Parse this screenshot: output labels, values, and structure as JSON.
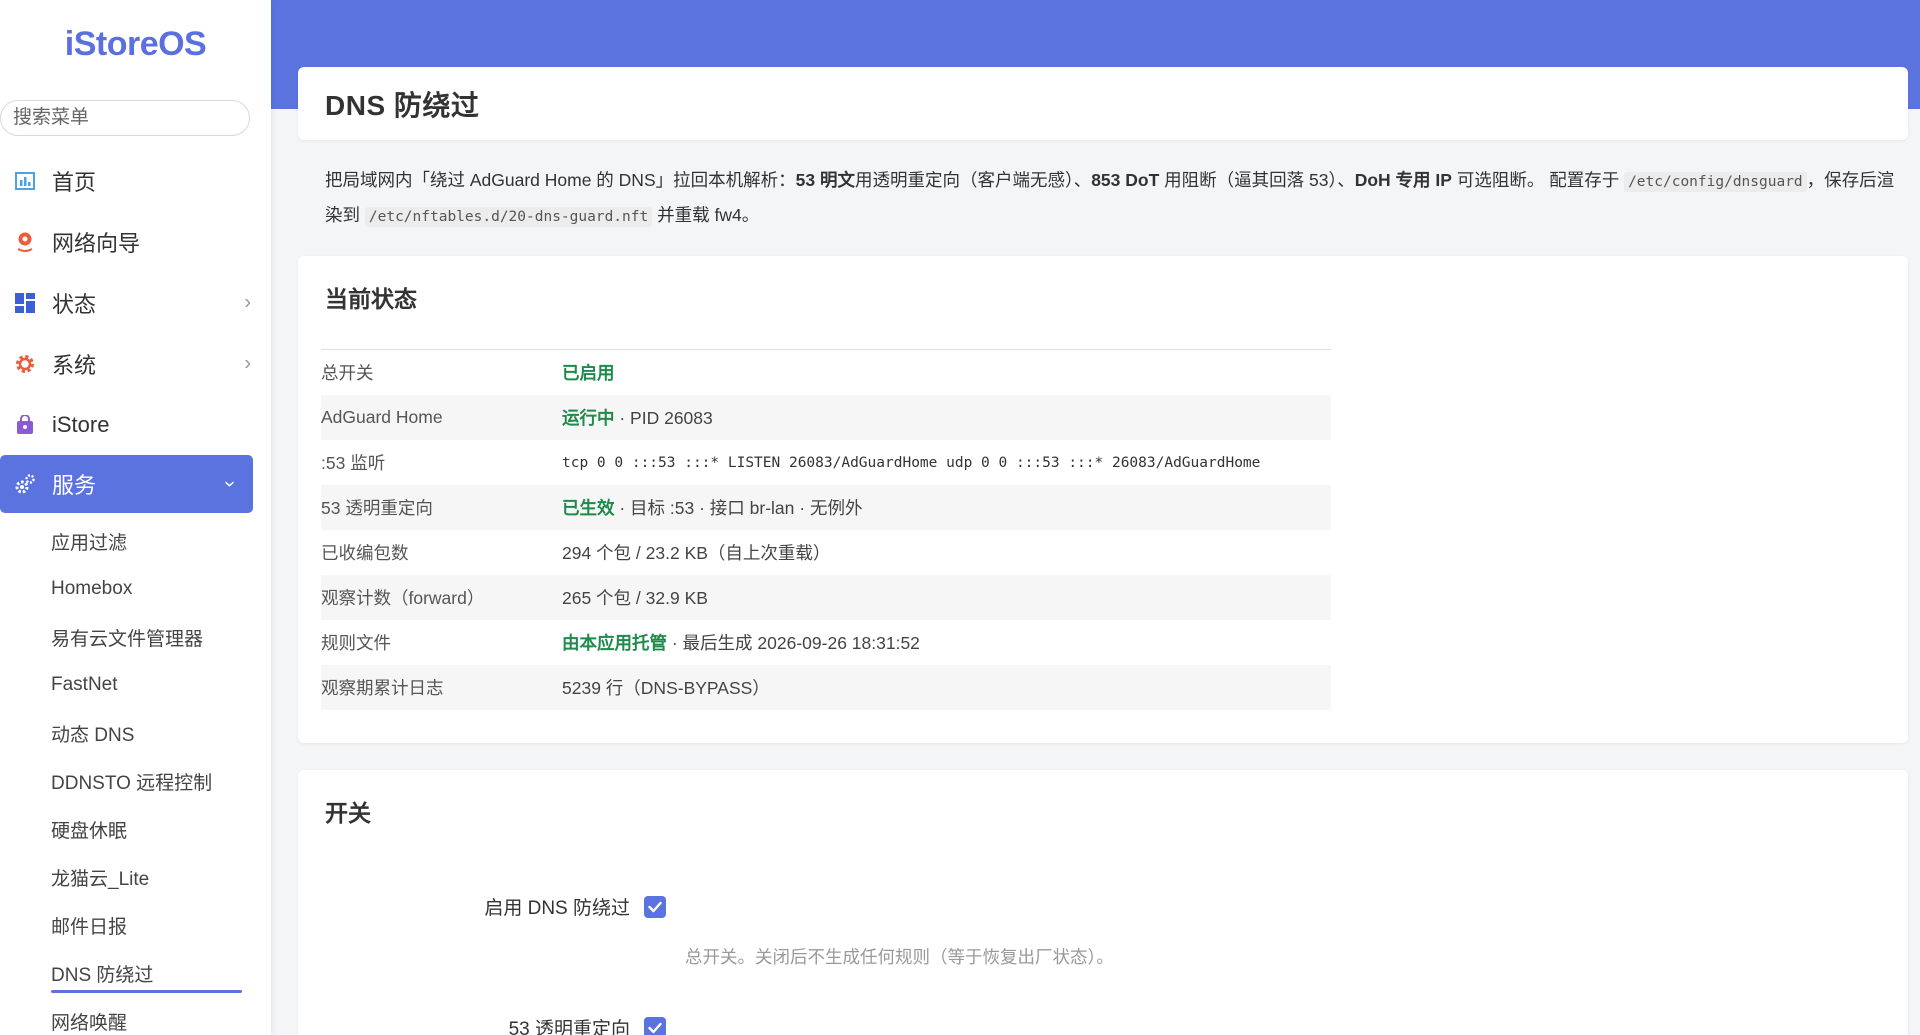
{
  "app": {
    "brand": "iStoreOS",
    "search_placeholder": "搜索菜单"
  },
  "sidebar": {
    "items": [
      {
        "label": "首页",
        "icon": "bar-chart-icon",
        "color": "#4aa3e6"
      },
      {
        "label": "网络向导",
        "icon": "globe-pin-icon",
        "color": "#ee5d3b"
      },
      {
        "label": "状态",
        "icon": "dashboard-icon",
        "color": "#3b5fd6"
      },
      {
        "label": "系统",
        "icon": "gear-icon",
        "color": "#ee5d3b"
      },
      {
        "label": "iStore",
        "icon": "bag-icon",
        "color": "#8b5ad6"
      },
      {
        "label": "服务",
        "icon": "gears-icon",
        "color": "#ffffff"
      }
    ],
    "sub_items": [
      "应用过滤",
      "Homebox",
      "易有云文件管理器",
      "FastNet",
      "动态 DNS",
      "DDNSTO 远程控制",
      "硬盘休眠",
      "龙猫云_Lite",
      "邮件日报",
      "DNS 防绕过",
      "网络唤醒"
    ],
    "current_sub": "DNS 防绕过"
  },
  "page": {
    "title": "DNS 防绕过",
    "desc": {
      "p1": "把局域网内「绕过 AdGuard Home 的 DNS」拉回本机解析：",
      "b1": "53 明文",
      "p2": "用透明重定向（客户端无感）、",
      "b2": "853 DoT",
      "p3": " 用阻断（逼其回落 53）、",
      "b3": "DoH 专用 IP",
      "p4": " 可选阻断。 配置存于 ",
      "code1": "/etc/config/dnsguard",
      "p5": "，保存后渲染到 ",
      "code2": "/etc/nftables.d/20-dns-guard.nft",
      "p6": " 并重载 fw4。"
    }
  },
  "status": {
    "title": "当前状态",
    "rows": [
      {
        "k": "总开关",
        "ok": "已启用",
        "rest": ""
      },
      {
        "k": "AdGuard Home",
        "ok": "运行中",
        "rest": " · PID 26083"
      },
      {
        "k": ":53 监听",
        "mono": "tcp 0 0 :::53 :::* LISTEN 26083/AdGuardHome udp 0 0 :::53 :::* 26083/AdGuardHome"
      },
      {
        "k": "53 透明重定向",
        "ok": "已生效",
        "rest": " · 目标 :53 · 接口 br-lan · 无例外"
      },
      {
        "k": "已收编包数",
        "ok": "",
        "rest": "294 个包 / 23.2 KB（自上次重载）"
      },
      {
        "k": "观察计数（forward）",
        "ok": "",
        "rest": "265 个包 / 32.9 KB"
      },
      {
        "k": "规则文件",
        "ok": "由本应用托管",
        "rest": " · 最后生成 2026-09-26 18:31:52"
      },
      {
        "k": "观察期累计日志",
        "ok": "",
        "rest": "5239 行（DNS-BYPASS）"
      }
    ]
  },
  "switch": {
    "title": "开关",
    "enable_label": "启用 DNS 防绕过",
    "enable_checked": true,
    "enable_hint": "总开关。关闭后不生成任何规则（等于恢复出厂状态）。",
    "redirect_label": "53 透明重定向",
    "redirect_checked": true
  }
}
